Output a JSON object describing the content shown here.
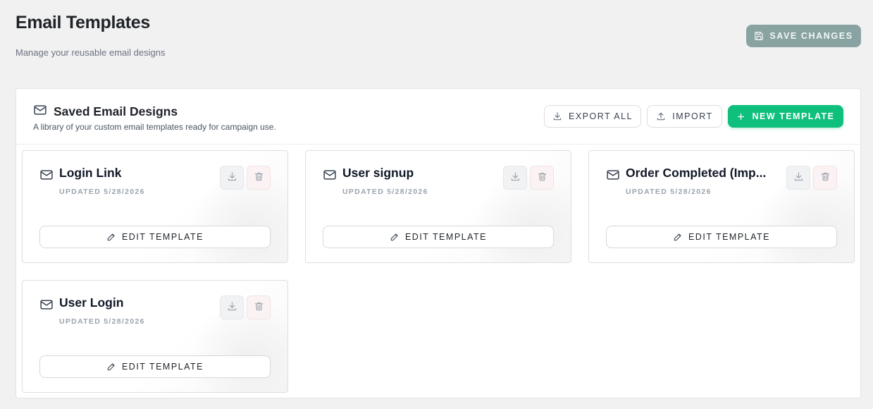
{
  "page": {
    "title": "Email Templates",
    "subtitle": "Manage your reusable email designs"
  },
  "header": {
    "save_label": "SAVE CHANGES"
  },
  "panel": {
    "title": "Saved Email Designs",
    "description": "A library of your custom email templates ready for campaign use.",
    "export_label": "EXPORT ALL",
    "import_label": "IMPORT",
    "new_label": "NEW TEMPLATE"
  },
  "templates": [
    {
      "name": "Login Link",
      "updated": "UPDATED 5/28/2026",
      "edit_label": "EDIT TEMPLATE"
    },
    {
      "name": "User signup",
      "updated": "UPDATED 5/28/2026",
      "edit_label": "EDIT TEMPLATE"
    },
    {
      "name": "Order Completed (Imp...",
      "updated": "UPDATED 5/28/2026",
      "edit_label": "EDIT TEMPLATE"
    },
    {
      "name": "User Login",
      "updated": "UPDATED 5/28/2026",
      "edit_label": "EDIT TEMPLATE"
    }
  ],
  "icons": {
    "save": "save-icon",
    "panel": "mail-icon",
    "export": "download-icon",
    "import": "upload-icon",
    "new": "plus-icon",
    "card": "mail-icon",
    "download": "download-icon",
    "delete": "trash-icon",
    "edit": "pencil-icon"
  },
  "colors": {
    "background": "#f1f1f1",
    "accent": "#0fbf7c",
    "save_button": "#89a3a3",
    "muted_text": "#9aa3ad",
    "danger_icon": "#e2a0a0"
  }
}
